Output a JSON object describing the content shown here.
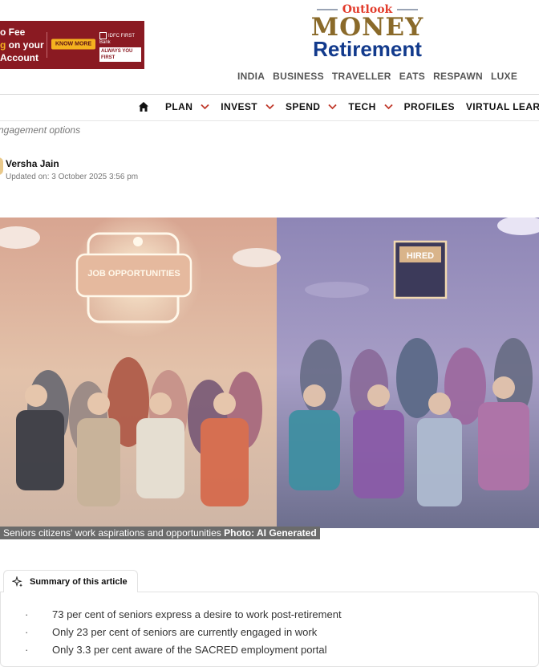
{
  "ad": {
    "line1": "o Fee",
    "line2a": "g",
    "line2b": " on your",
    "line3": "Account",
    "button": "KNOW MORE",
    "bank_name": "IDFC FIRST Bank",
    "bank_tag": "ALWAYS YOU FIRST"
  },
  "logo": {
    "outlook": "Outlook",
    "money": "MONEY",
    "retirement": "Retirement"
  },
  "top_nav": [
    "INDIA",
    "BUSINESS",
    "TRAVELLER",
    "EATS",
    "RESPAWN",
    "LUXE"
  ],
  "main_nav": [
    {
      "label": "PLAN",
      "dropdown": true
    },
    {
      "label": "INVEST",
      "dropdown": true
    },
    {
      "label": "SPEND",
      "dropdown": true
    },
    {
      "label": "TECH",
      "dropdown": true
    },
    {
      "label": "PROFILES",
      "dropdown": false
    },
    {
      "label": "VIRTUAL LEARNING",
      "dropdown": false
    }
  ],
  "engagement_text": "ngagement options",
  "article": {
    "author": "Versha Jain",
    "updated": "Updated on: 3 October 2025 3:56 pm"
  },
  "hero": {
    "left_sign": "JOB OPPORTUNITIES",
    "right_sign": "HIRED",
    "caption": "Seniors citizens' work aspirations and opportunities ",
    "caption_credit": "Photo: AI Generated"
  },
  "summary": {
    "title": "Summary of this article",
    "points": [
      "73 per cent of seniors express a desire to work post-retirement",
      "Only 23 per cent of seniors are currently engaged in work",
      "Only 3.3 per cent aware of the SACRED employment portal"
    ]
  },
  "colors": {
    "ad_bg": "#8a1a22",
    "ad_accent": "#f5b21f",
    "logo_red": "#e23b2b",
    "logo_gold": "#8a6a2a",
    "logo_blue": "#123a8c",
    "nav_chevron": "#c0392b"
  }
}
